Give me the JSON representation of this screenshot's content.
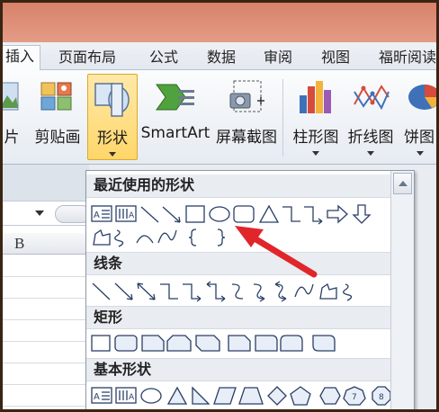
{
  "tabs": [
    {
      "label": "插入",
      "active": true
    },
    {
      "label": "页面布局"
    },
    {
      "label": "公式"
    },
    {
      "label": "数据"
    },
    {
      "label": "审阅"
    },
    {
      "label": "视图"
    },
    {
      "label": "福昕阅读"
    }
  ],
  "ribbon": {
    "picture_partial": "片",
    "clipart": "剪贴画",
    "shapes": "形状",
    "smartart": "SmartArt",
    "screenshot": "屏幕截图",
    "column_chart": "柱形图",
    "line_chart": "折线图",
    "pie_chart": "饼图"
  },
  "sheet": {
    "column_b": "B"
  },
  "panel": {
    "recent_header": "最近使用的形状",
    "lines_header": "线条",
    "rect_header": "矩形",
    "basic_header": "基本形状"
  },
  "colors": {
    "titlebar": "#e39c86",
    "shapes_highlight": "#ffd66a",
    "annotation_arrow": "#e0262b",
    "shape_stroke": "#2a3f66"
  }
}
